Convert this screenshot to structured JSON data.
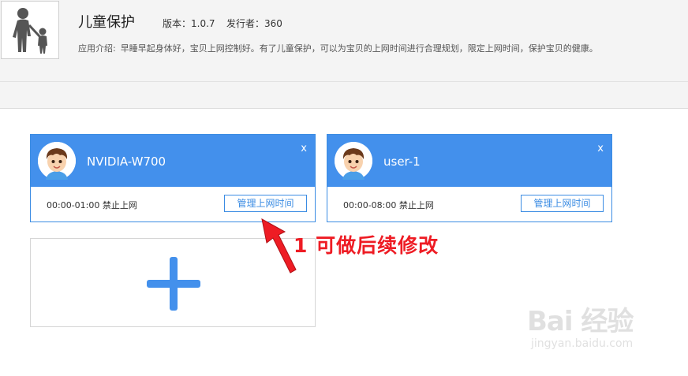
{
  "app": {
    "name": "儿童保护",
    "version_label": "版本：1.0.7",
    "publisher_label": "发行者：360",
    "desc_label": "应用介绍:",
    "desc_text": "早睡早起身体好，宝贝上网控制好。有了儿童保护，可以为宝贝的上网时间进行合理规划，限定上网时间，保护宝贝的健康。"
  },
  "cards": [
    {
      "name": "NVIDIA-W700",
      "schedule": "00:00-01:00 禁止上网",
      "manage_label": "管理上网时间",
      "close_label": "x"
    },
    {
      "name": "user-1",
      "schedule": "00:00-08:00 禁止上网",
      "manage_label": "管理上网时间",
      "close_label": "x"
    }
  ],
  "annotation": {
    "text": "1 可做后续修改"
  },
  "watermark": {
    "logo": "Bai 经验",
    "url": "jingyan.baidu.com"
  },
  "colors": {
    "accent": "#4390ec",
    "annotation": "#ee1c24"
  },
  "icons": {
    "app": "parent-child-icon",
    "avatar": "boy-avatar-icon",
    "add": "plus-icon"
  }
}
